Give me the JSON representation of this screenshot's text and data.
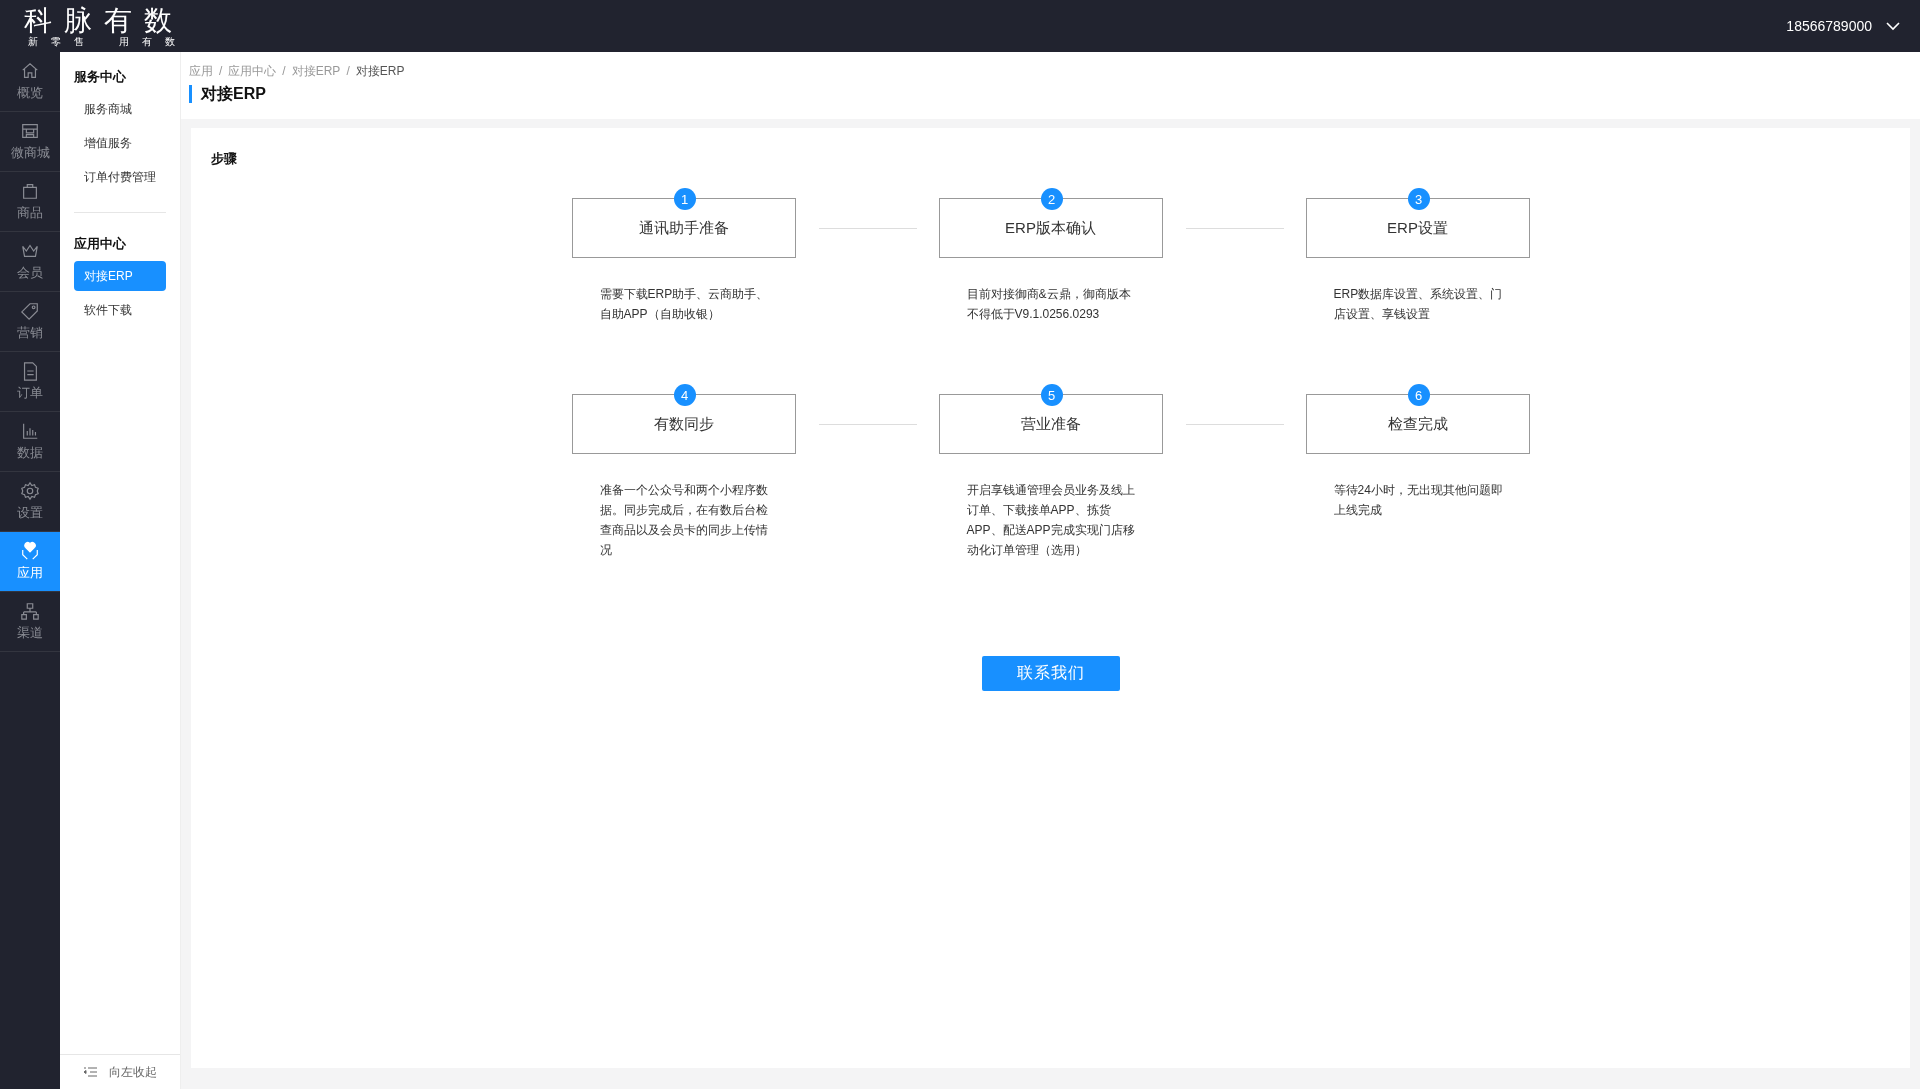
{
  "topbar": {
    "logo_title": "科脉有数",
    "logo_subtitle_left": "新零售",
    "logo_subtitle_right": "用有数",
    "account": "18566789000"
  },
  "nav_rail": [
    {
      "label": "概览",
      "selected": false
    },
    {
      "label": "微商城",
      "selected": false
    },
    {
      "label": "商品",
      "selected": false
    },
    {
      "label": "会员",
      "selected": false
    },
    {
      "label": "营销",
      "selected": false
    },
    {
      "label": "订单",
      "selected": false
    },
    {
      "label": "数据",
      "selected": false
    },
    {
      "label": "设置",
      "selected": false
    },
    {
      "label": "应用",
      "selected": true
    },
    {
      "label": "渠道",
      "selected": false
    }
  ],
  "sub_menu": [
    {
      "title": "服务中心",
      "items": [
        {
          "label": "服务商城",
          "selected": false
        },
        {
          "label": "增值服务",
          "selected": false
        },
        {
          "label": "订单付费管理",
          "selected": false
        }
      ]
    },
    {
      "title": "应用中心",
      "items": [
        {
          "label": "对接ERP",
          "selected": true
        },
        {
          "label": "软件下载",
          "selected": false
        }
      ]
    }
  ],
  "collapse": "向左收起",
  "breadcrumb": {
    "separator": "/",
    "items": [
      "应用",
      "应用中心",
      "对接ERP",
      "对接ERP"
    ]
  },
  "page_title": "对接ERP",
  "section_title": "步骤",
  "steps": [
    {
      "number": "1",
      "title": "通讯助手准备",
      "description": "需要下载ERP助手、云商助手、自助APP（自助收银）"
    },
    {
      "number": "2",
      "title": "ERP版本确认",
      "description": "目前对接御商&云鼎，御商版本不得低于V9.1.0256.0293"
    },
    {
      "number": "3",
      "title": "ERP设置",
      "description": "ERP数据库设置、系统设置、门店设置、享钱设置"
    },
    {
      "number": "4",
      "title": "有数同步",
      "description": "准备一个公众号和两个小程序数据。同步完成后，在有数后台检查商品以及会员卡的同步上传情况"
    },
    {
      "number": "5",
      "title": "营业准备",
      "description": "开启享钱通管理会员业务及线上订单、下载接单APP、拣货APP、配送APP完成实现门店移动化订单管理（选用）"
    },
    {
      "number": "6",
      "title": "检查完成",
      "description": "等待24小时，无出现其他问题即上线完成"
    }
  ],
  "contact_button": "联系我们"
}
